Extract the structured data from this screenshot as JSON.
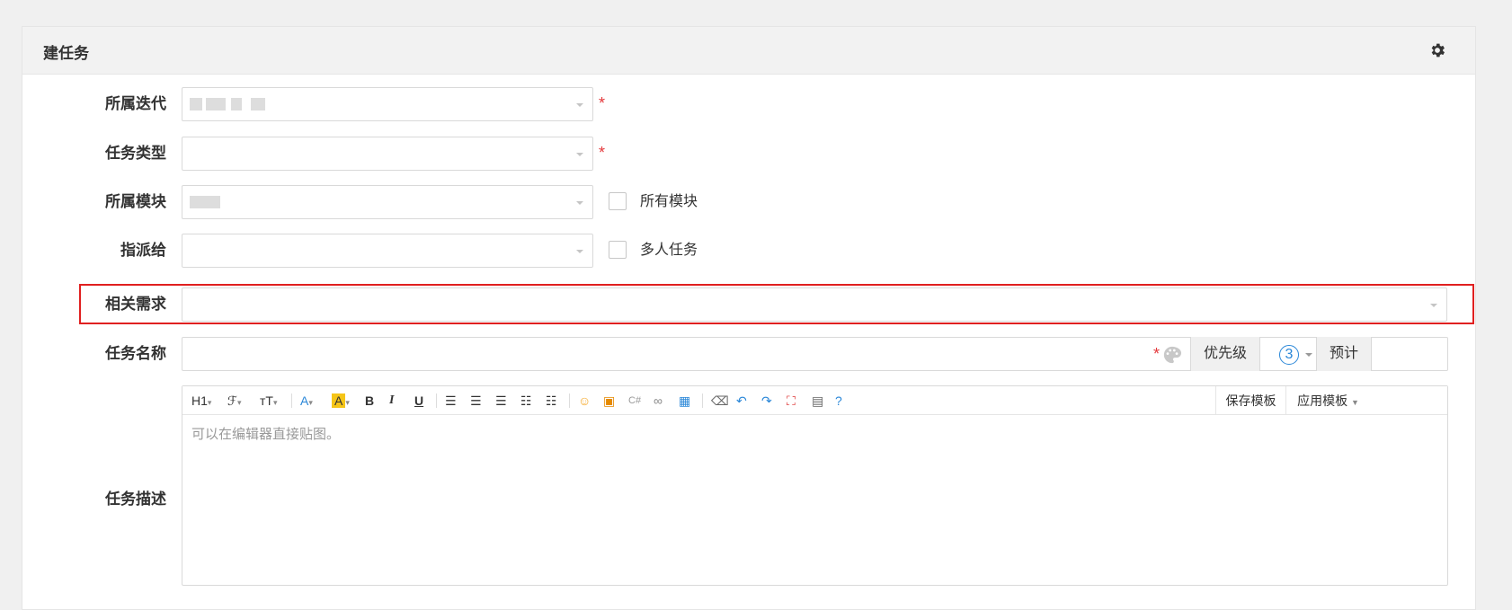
{
  "panel": {
    "title": "建任务",
    "settings_icon": "gear-icon"
  },
  "form": {
    "iteration": {
      "label": "所属迭代",
      "value": "",
      "required": true
    },
    "task_type": {
      "label": "任务类型",
      "value": "",
      "required": true
    },
    "module": {
      "label": "所属模块",
      "value": "",
      "all_modules_label": "所有模块"
    },
    "assignee": {
      "label": "指派给",
      "value": "",
      "multi_label": "多人任务"
    },
    "story": {
      "label": "相关需求",
      "value": ""
    },
    "task_name": {
      "label": "任务名称",
      "value": "",
      "required": true,
      "priority_label": "优先级",
      "priority_value": "3",
      "estimate_label": "预计",
      "estimate_value": ""
    },
    "description": {
      "label": "任务描述",
      "placeholder": "可以在编辑器直接贴图。",
      "toolbar": {
        "heading": "H1",
        "font": "ℱ",
        "font_size": "тT",
        "font_color": "A",
        "bg_color": "A",
        "bold": "B",
        "italic": "I",
        "underline": "U",
        "save_template": "保存模板",
        "apply_template": "应用模板"
      }
    }
  },
  "colors": {
    "required": "#e4393c",
    "highlight": "#e02020",
    "priority_accent": "#2a87d8"
  }
}
